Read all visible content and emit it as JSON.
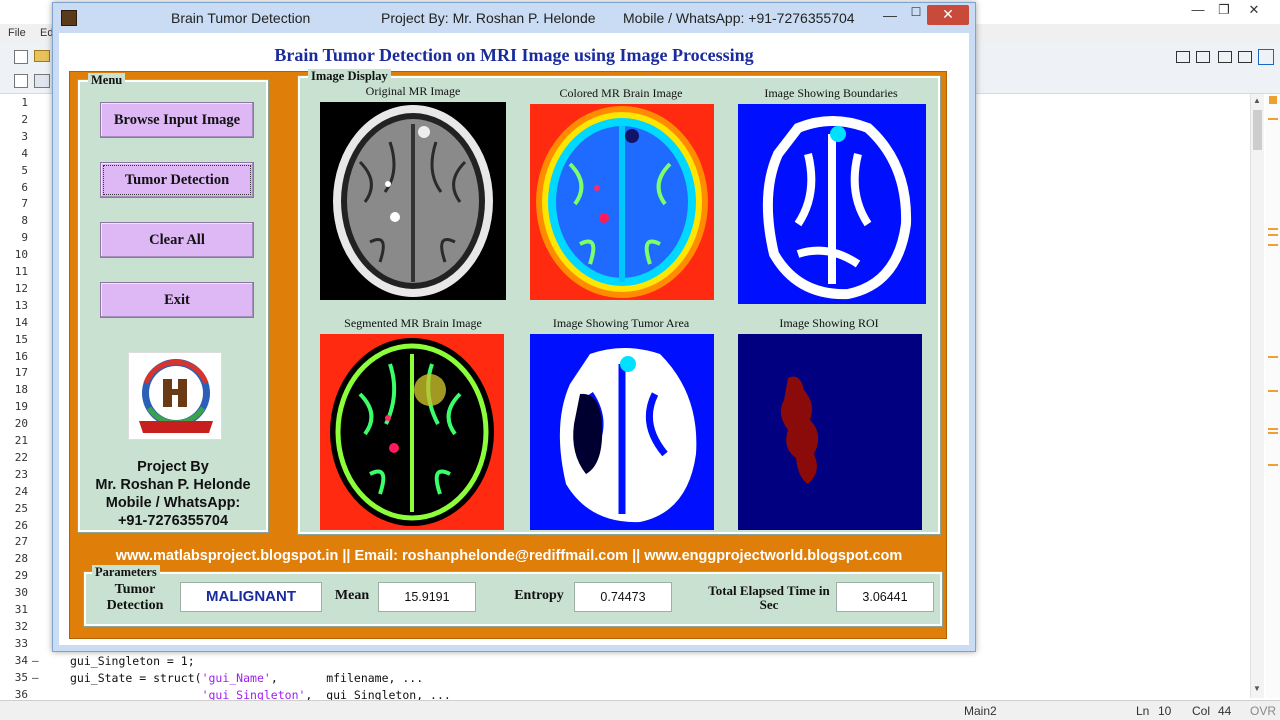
{
  "editor": {
    "menu": [
      "File",
      "Ed"
    ],
    "line_numbers": [
      "1",
      "2",
      "3",
      "4",
      "5",
      "6",
      "7",
      "8",
      "9",
      "10",
      "11",
      "12",
      "13",
      "14",
      "15",
      "16",
      "17",
      "18",
      "19",
      "20",
      "21",
      "22",
      "23",
      "24",
      "25",
      "26",
      "27",
      "28",
      "29",
      "30",
      "31",
      "32",
      "33",
      "34",
      "35",
      "36"
    ],
    "code_lines": [
      {
        "n": "34",
        "text": "gui_Singleton = 1;"
      },
      {
        "n": "35",
        "pre": "gui_State = struct(",
        "str": "'gui_Name'",
        "post": ",       mfilename, ..."
      },
      {
        "n": "36",
        "pre": "                   ",
        "str": "'gui_Singleton'",
        "post": ",  gui_Singleton, ..."
      }
    ],
    "status": {
      "file": "Main2",
      "ln_label": "Ln",
      "ln": "10",
      "col_label": "Col",
      "col": "44",
      "mode": "OVR"
    }
  },
  "window": {
    "title": "Brain Tumor Detection",
    "project": "Project By: Mr. Roshan P. Helonde",
    "mobile": "Mobile / WhatsApp: +91-7276355704",
    "heading": "Brain Tumor Detection on MRI Image using Image Processing"
  },
  "menu": {
    "title": "Menu",
    "buttons": [
      {
        "id": "browse",
        "label": "Browse Input Image"
      },
      {
        "id": "detect",
        "label": "Tumor Detection"
      },
      {
        "id": "clear",
        "label": "Clear All"
      },
      {
        "id": "exit",
        "label": "Exit"
      }
    ],
    "credit": [
      "Project By",
      "Mr. Roshan P. Helonde",
      "Mobile / WhatsApp:",
      "+91-7276355704"
    ]
  },
  "display": {
    "title": "Image Display",
    "captions": [
      "Original MR Image",
      "Colored MR Brain Image",
      "Image Showing Boundaries",
      "Segmented MR Brain Image",
      "Image Showing Tumor Area",
      "Image Showing ROI"
    ]
  },
  "links": "www.matlabsproject.blogspot.in ||  Email: roshanphelonde@rediffmail.com  ||  www.enggprojectworld.blogspot.com",
  "parameters": {
    "title": "Parameters",
    "tumor_label": "Tumor Detection",
    "tumor_value": "MALIGNANT",
    "mean_label": "Mean",
    "mean_value": "15.9191",
    "entropy_label": "Entropy",
    "entropy_value": "0.74473",
    "time_label": "Total Elapsed Time in Sec",
    "time_value": "3.06441"
  },
  "colors": {
    "heading": "#1a2c9c",
    "frame": "#e07e0a",
    "panel": "#c9e1d1",
    "button": "#ddb8f5",
    "result": "#1a2c9c",
    "close": "#c74a3b"
  }
}
